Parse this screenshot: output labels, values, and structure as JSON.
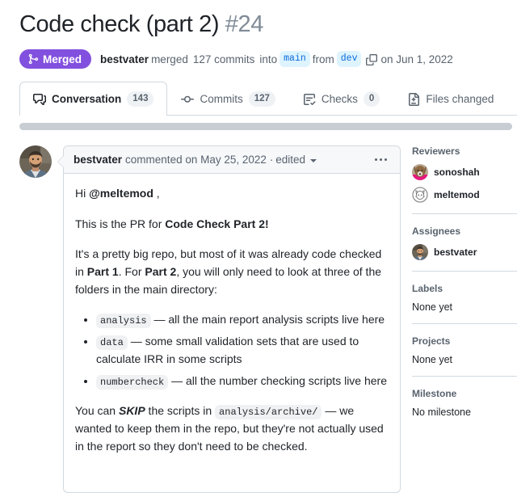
{
  "header": {
    "title": "Code check (part 2)",
    "number": "#24",
    "state_badge": {
      "label": "Merged",
      "icon": "git-merge-icon",
      "color": "#8250df"
    },
    "meta": {
      "author": "bestvater",
      "action": "merged",
      "commit_count": "127 commits",
      "into_word": "into",
      "base_branch": "main",
      "from_word": "from",
      "head_branch": "dev",
      "copy_icon": "copy-icon",
      "date": "on Jun 1, 2022"
    },
    "branch_chip_bg": "#ddf4ff",
    "branch_chip_color": "#0969da"
  },
  "tabs": [
    {
      "label": "Conversation",
      "count": "143",
      "icon": "comment-discussion-icon",
      "active": true
    },
    {
      "label": "Commits",
      "count": "127",
      "icon": "git-commit-icon",
      "active": false
    },
    {
      "label": "Checks",
      "count": "0",
      "icon": "checklist-icon",
      "active": false
    },
    {
      "label": "Files changed",
      "count": "",
      "icon": "file-diff-icon",
      "active": false
    }
  ],
  "comment": {
    "avatar": "bestvater-avatar",
    "author": "bestvater",
    "action": "commented on",
    "date": "May 25, 2022",
    "separator": "·",
    "edited": "edited",
    "menu_icon": "kebab-menu-icon",
    "greeting_prefix": "Hi ",
    "greeting_mention": "@meltemod",
    "greeting_suffix": " ,",
    "intro_prefix": "This is the PR for ",
    "intro_bold": "Code Check Part 2!",
    "para2_a": "It's a pretty big repo, but most of it was already code checked in ",
    "para2_b1": "Part 1",
    "para2_c": ". For ",
    "para2_b2": "Part 2",
    "para2_d": ", you will only need to look at three of the folders in the main directory:",
    "list": [
      {
        "code": "analysis",
        "text": " — all the main report analysis scripts live here"
      },
      {
        "code": "data",
        "text": " — some small validation sets that are used to calculate IRR in some scripts"
      },
      {
        "code": "numbercheck",
        "text": " — all the number checking scripts live here"
      }
    ],
    "skip_a": "You can ",
    "skip_em": "SKIP",
    "skip_b": " the scripts in ",
    "skip_code": "analysis/archive/",
    "skip_c": " — we wanted to keep them in the repo, but they're not actually used in the report so they don't need to be checked."
  },
  "sidebar": {
    "reviewers": {
      "title": "Reviewers",
      "users": [
        {
          "name": "sonoshah",
          "avatar": "sonoshah-avatar"
        },
        {
          "name": "meltemod",
          "avatar": "meltemod-avatar"
        }
      ]
    },
    "assignees": {
      "title": "Assignees",
      "users": [
        {
          "name": "bestvater",
          "avatar": "bestvater-avatar"
        }
      ]
    },
    "labels": {
      "title": "Labels",
      "value": "None yet"
    },
    "projects": {
      "title": "Projects",
      "value": "None yet"
    },
    "milestone": {
      "title": "Milestone",
      "value": "No milestone"
    }
  }
}
